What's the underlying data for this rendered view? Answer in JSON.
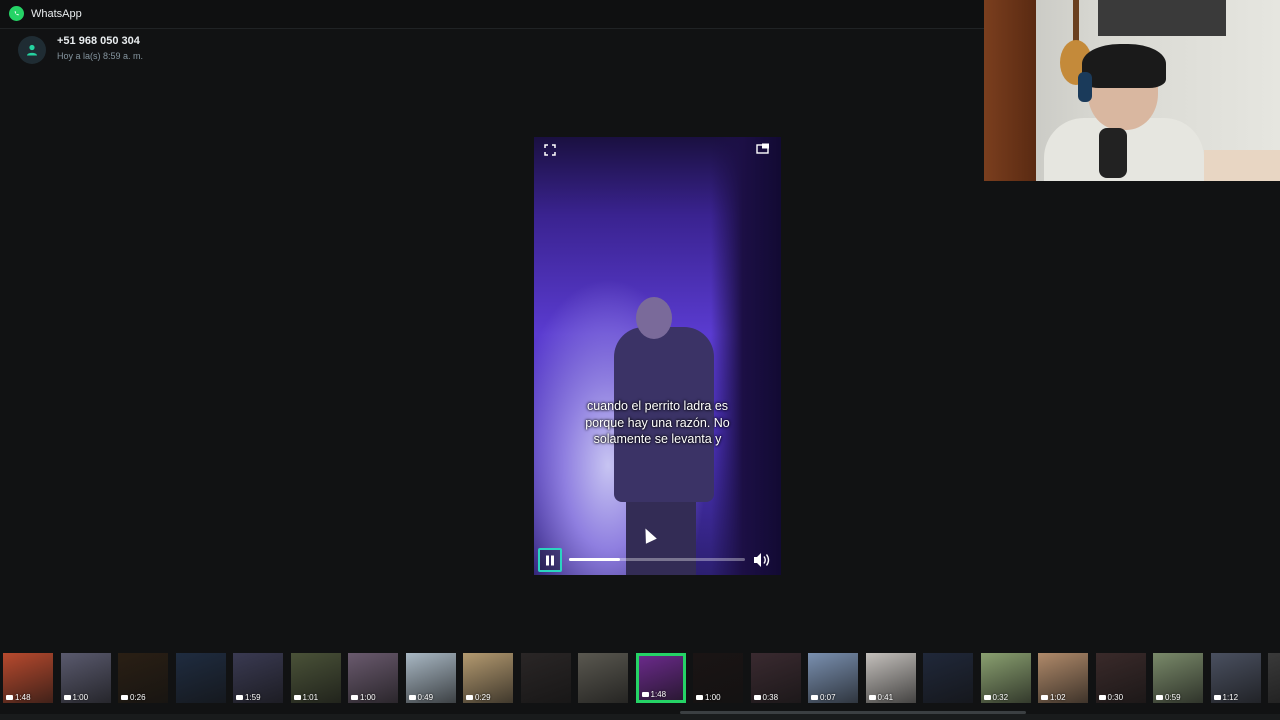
{
  "app": {
    "title": "WhatsApp",
    "icon": "whatsapp-logo"
  },
  "sender": {
    "name": "+51 968 050 304",
    "time": "Hoy a la(s) 8:59 a. m."
  },
  "video": {
    "subtitle_lines": [
      "cuando el perrito ladra es",
      "porque hay una razón. No",
      "solamente se levanta y"
    ],
    "progress": 0.29,
    "state": "playing",
    "icons": {
      "fullscreen": "expand-icon",
      "popout": "picture-in-picture-icon",
      "pause": "pause-icon",
      "volume": "volume-icon"
    }
  },
  "filmstrip": {
    "active_index": 11,
    "thumbs": [
      {
        "duration": "1:48",
        "color": "#b84a2e"
      },
      {
        "duration": "1:00",
        "color": "#5a5a6e"
      },
      {
        "duration": "0:26",
        "color": "#2a1f14"
      },
      {
        "duration": "",
        "color": "#1f2c40"
      },
      {
        "duration": "1:59",
        "color": "#3a3a52"
      },
      {
        "duration": "1:01",
        "color": "#4a5238"
      },
      {
        "duration": "1:00",
        "color": "#6a5a6e"
      },
      {
        "duration": "0:49",
        "color": "#a9b8c4"
      },
      {
        "duration": "0:29",
        "color": "#b49a70"
      },
      {
        "duration": "",
        "color": "#2a2626"
      },
      {
        "duration": "",
        "color": "#5a5850"
      },
      {
        "duration": "1:48",
        "color": "#6a2a8a"
      },
      {
        "duration": "1:00",
        "color": "#1a1414"
      },
      {
        "duration": "0:38",
        "color": "#3a2a30"
      },
      {
        "duration": "0:07",
        "color": "#7a90b0"
      },
      {
        "duration": "0:41",
        "color": "#c4c0bc"
      },
      {
        "duration": "",
        "color": "#20283a"
      },
      {
        "duration": "0:32",
        "color": "#8aa070"
      },
      {
        "duration": "1:02",
        "color": "#b08a6a"
      },
      {
        "duration": "0:30",
        "color": "#3a2a2a"
      },
      {
        "duration": "0:59",
        "color": "#7a8a6a"
      },
      {
        "duration": "1:12",
        "color": "#4a5060"
      },
      {
        "duration": "",
        "color": "#3a3a3a"
      }
    ]
  },
  "colors": {
    "accent": "#25d366",
    "background": "#111213",
    "play_border": "#2bd4c0"
  }
}
